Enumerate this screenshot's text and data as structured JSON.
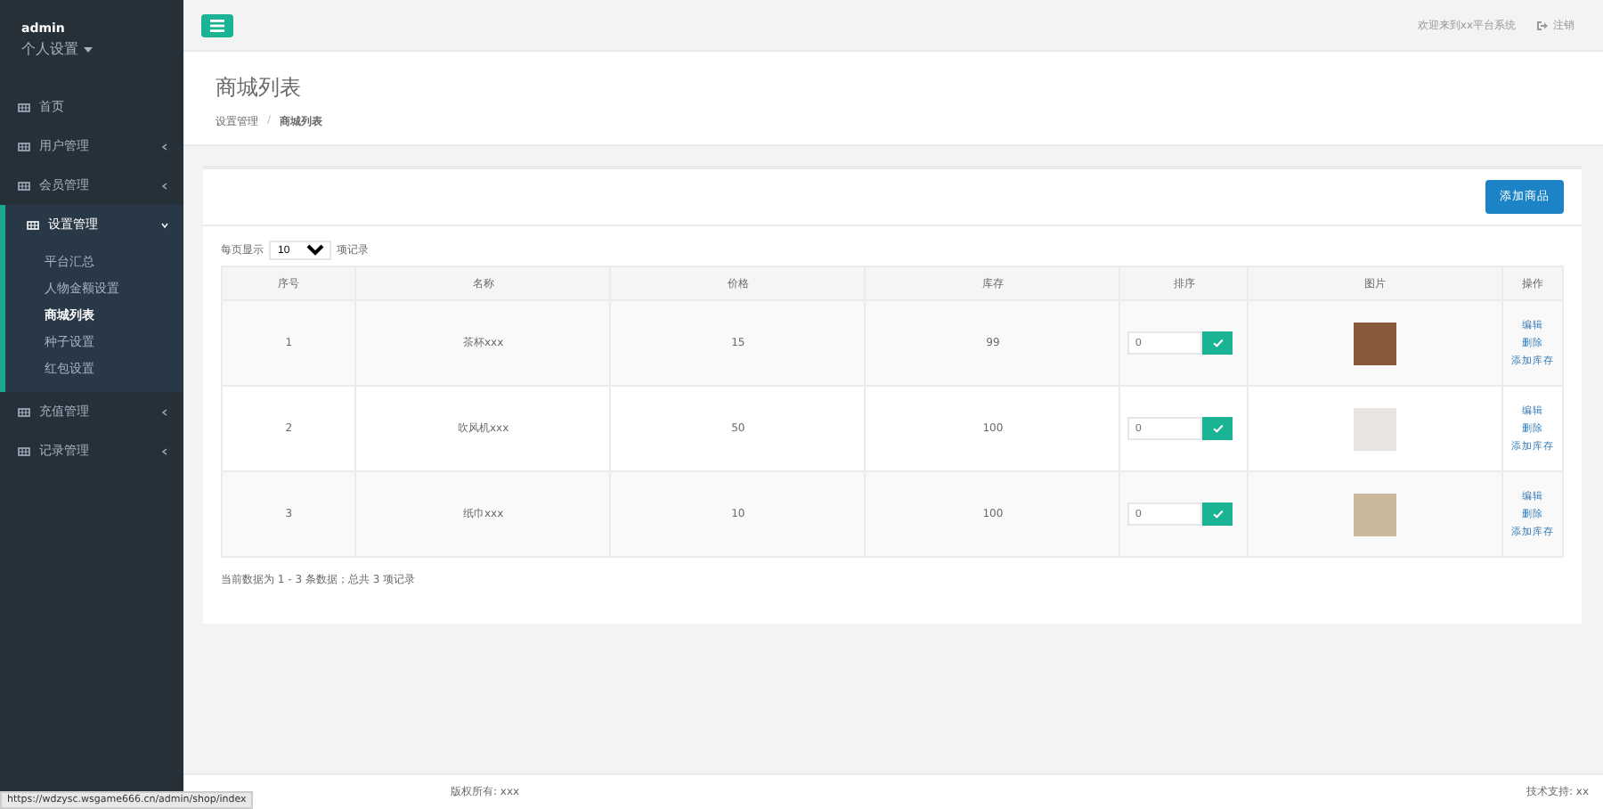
{
  "user": {
    "name": "admin",
    "menu": "个人设置"
  },
  "sidebar": {
    "items": [
      {
        "label": "首页",
        "expanded": false,
        "has_caret": false
      },
      {
        "label": "用户管理",
        "expanded": false,
        "has_caret": true
      },
      {
        "label": "会员管理",
        "expanded": false,
        "has_caret": true
      },
      {
        "label": "设置管理",
        "expanded": true,
        "has_caret": true,
        "children": [
          {
            "label": "平台汇总",
            "selected": false
          },
          {
            "label": "人物金额设置",
            "selected": false
          },
          {
            "label": "商城列表",
            "selected": true
          },
          {
            "label": "种子设置",
            "selected": false
          },
          {
            "label": "红包设置",
            "selected": false
          }
        ]
      },
      {
        "label": "充值管理",
        "expanded": false,
        "has_caret": true
      },
      {
        "label": "记录管理",
        "expanded": false,
        "has_caret": true
      }
    ]
  },
  "topbar": {
    "welcome": "欢迎来到xx平台系统",
    "logout": "注销"
  },
  "page": {
    "title": "商城列表",
    "breadcrumb": [
      "设置管理",
      "商城列表"
    ],
    "breadcrumb_separator": "/"
  },
  "toolbar": {
    "add_button": "添加商品"
  },
  "page_size": {
    "prefix": "每页显示",
    "value": "10",
    "suffix": "项记录"
  },
  "table": {
    "columns": [
      "序号",
      "名称",
      "价格",
      "库存",
      "排序",
      "图片",
      "操作"
    ],
    "rows": [
      {
        "index": "1",
        "name": "茶杯xxx",
        "price": "15",
        "stock": "99",
        "sort": "0",
        "actions": [
          "编辑",
          "删除",
          "添加库存"
        ]
      },
      {
        "index": "2",
        "name": "吹风机xxx",
        "price": "50",
        "stock": "100",
        "sort": "0",
        "actions": [
          "编辑",
          "删除",
          "添加库存"
        ]
      },
      {
        "index": "3",
        "name": "纸巾xxx",
        "price": "10",
        "stock": "100",
        "sort": "0",
        "actions": [
          "编辑",
          "删除",
          "添加库存"
        ]
      }
    ]
  },
  "summary": "当前数据为 1 - 3 条数据；总共 3 项记录",
  "footer": {
    "copyright": "版权所有: xxx",
    "support": "技术支持: xx"
  },
  "status_url": "https://wdzysc.wsgame666.cn/admin/shop/index"
}
